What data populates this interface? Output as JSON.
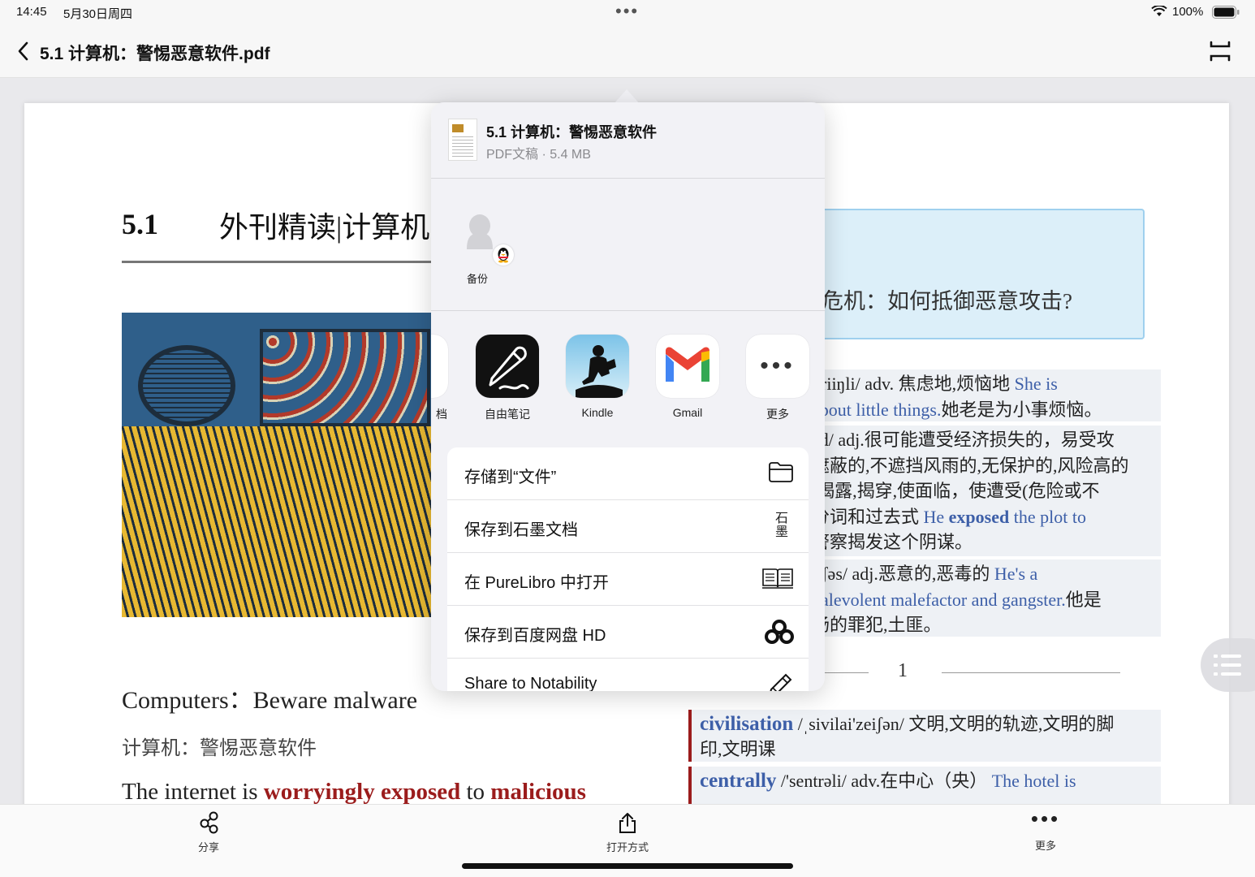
{
  "status_bar": {
    "time": "14:45",
    "date": "5月30日周四",
    "battery": "100%"
  },
  "nav": {
    "title": "5.1 计算机：警惕恶意软件.pdf"
  },
  "pdf": {
    "section_number": "5.1",
    "section_title": "外刊精读|计算机",
    "en_heading": "Computers：Beware malware",
    "cn_heading": "计算机：警惕恶意软件",
    "body_line": {
      "prefix": "The internet is ",
      "hl1": "worryingly exposed",
      "mid": " to ",
      "hl2": "malicious"
    },
    "question": "危机：如何抵御恶意攻击?",
    "vocab_1": {
      "line1_pre": "ʌriiŋli/ adv. 焦虑地,烦恼地  ",
      "line1_ex": "She is",
      "line2_ex": "about little things.",
      "line2_cn": "她老是为小事烦恼。"
    },
    "vocab_2": {
      "line1": "zd/ adj.很可能遭受经济损失的，易受攻",
      "line2": "遮蔽的,不遮挡风雨的,无保护的,风险高的",
      "line3": ";揭露,揭穿,使面临，使遭受(危险或不",
      "line4_pre": "分词和过去式  ",
      "line4_ex_a": "He ",
      "line4_ex_b": "exposed",
      "line4_ex_c": " the plot to",
      "line5": "警察揭发这个阴谋。"
    },
    "vocab_3": {
      "line1_pre": "lɪʃəs/ adj.恶意的,恶毒的  ",
      "line1_ex": "He's a",
      "line2_ex": "nalevolent malefactor and gangster.",
      "line2_cn": "他是",
      "line3": "肠的罪犯,土匪。"
    },
    "page_number": "1",
    "card_1": {
      "word": "civilisation",
      "phonetic": " /ˌsivilai'zeiʃən/  文明,文明的轨迹,文明的脚",
      "line2": "印,文明课"
    },
    "card_2": {
      "word": "centrally",
      "phonetic": " /'sentrəli/  adv.在中心（央）  ",
      "example": "The hotel is"
    }
  },
  "share_sheet": {
    "file_name": "5.1 计算机：警惕恶意软件",
    "file_meta": "PDF文稿 · 5.4 MB",
    "contact_label": "备份",
    "apps": [
      {
        "label": "档",
        "icon": "document-app-icon"
      },
      {
        "label": "自由笔记",
        "icon": "freeform-notes-icon"
      },
      {
        "label": "Kindle",
        "icon": "kindle-icon"
      },
      {
        "label": "Gmail",
        "icon": "gmail-icon"
      },
      {
        "label": "更多",
        "icon": "more-icon"
      }
    ],
    "actions": [
      {
        "label": "存储到“文件”",
        "icon": "folder-icon"
      },
      {
        "label": "保存到石墨文档",
        "icon": "shimo-icon",
        "icon_text": "石\n墨"
      },
      {
        "label": "在 PureLibro 中打开",
        "icon": "book-icon"
      },
      {
        "label": "保存到百度网盘 HD",
        "icon": "baidu-cloud-icon"
      },
      {
        "label": "Share to Notability",
        "icon": "pencil-icon"
      }
    ]
  },
  "toolbar": {
    "share": "分享",
    "open_with": "打开方式",
    "more": "更多"
  },
  "colors": {
    "accent_red": "#9b1c1c",
    "example_blue": "#3d5fa8",
    "question_bg": "#dceff9"
  }
}
